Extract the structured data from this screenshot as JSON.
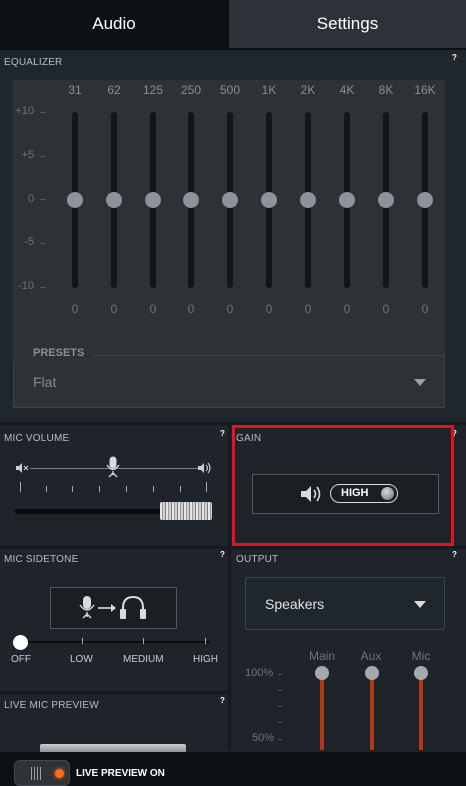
{
  "tabs": [
    {
      "label": "Audio"
    },
    {
      "label": "Settings"
    }
  ],
  "equalizer": {
    "title": "EQUALIZER",
    "help": "?",
    "db_labels": [
      "+10",
      "+5",
      "0",
      "-5",
      "-10"
    ],
    "bands": [
      {
        "freq": "31",
        "value": "0"
      },
      {
        "freq": "62",
        "value": "0"
      },
      {
        "freq": "125",
        "value": "0"
      },
      {
        "freq": "250",
        "value": "0"
      },
      {
        "freq": "500",
        "value": "0"
      },
      {
        "freq": "1K",
        "value": "0"
      },
      {
        "freq": "2K",
        "value": "0"
      },
      {
        "freq": "4K",
        "value": "0"
      },
      {
        "freq": "8K",
        "value": "0"
      },
      {
        "freq": "16K",
        "value": "0"
      }
    ],
    "presets_label": "PRESETS",
    "preset_value": "Flat"
  },
  "mic_volume": {
    "title": "MIC VOLUME",
    "help": "?",
    "level": 1.0
  },
  "gain": {
    "title": "GAIN",
    "help": "?",
    "value": "HIGH"
  },
  "mic_sidetone": {
    "title": "MIC SIDETONE",
    "help": "?",
    "labels": [
      "OFF",
      "LOW",
      "MEDIUM",
      "HIGH"
    ],
    "selected": "OFF"
  },
  "output": {
    "title": "OUTPUT",
    "help": "?",
    "selected": "Speakers",
    "mix_labels": [
      "Main",
      "Aux",
      "Mic"
    ],
    "scale": [
      "100%",
      "50%"
    ]
  },
  "live_mic_preview": {
    "title": "LIVE MIC PREVIEW",
    "help": "?",
    "toggle_label": "LIVE PREVIEW ON"
  },
  "colors": {
    "accent_orange": "#ff6a1a",
    "highlight_red": "#e3141f",
    "mix_fader": "#b03a18"
  }
}
